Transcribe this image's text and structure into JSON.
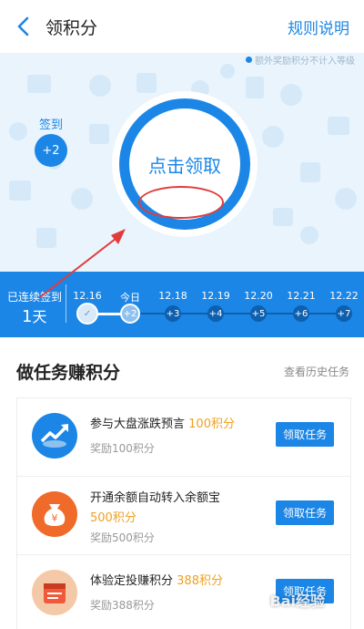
{
  "header": {
    "title": "领积分",
    "rules_label": "规则说明"
  },
  "hero": {
    "note": "额外奖励积分不计入等级",
    "signed_label": "签到",
    "signed_badge": "+2",
    "claim_label": "点击领取"
  },
  "streak": {
    "label": "已连续签到",
    "days_value": "1",
    "days_unit": "天",
    "days": [
      {
        "date": "12.16",
        "reward": "✓",
        "state": "done"
      },
      {
        "date": "今日",
        "reward": "+2",
        "state": "today"
      },
      {
        "date": "12.18",
        "reward": "+3",
        "state": "future"
      },
      {
        "date": "12.19",
        "reward": "+4",
        "state": "future"
      },
      {
        "date": "12.20",
        "reward": "+5",
        "state": "future"
      },
      {
        "date": "12.21",
        "reward": "+6",
        "state": "future"
      },
      {
        "date": "12.22",
        "reward": "+7",
        "state": "future"
      }
    ]
  },
  "tasks": {
    "title": "做任务赚积分",
    "history_label": "查看历史任务",
    "items": [
      {
        "name": "参与大盘涨跌预言",
        "points": "100积分",
        "reward": "奖励100积分",
        "button": "领取任务",
        "icon": "trend-chart-icon",
        "color": "#1c86e6"
      },
      {
        "name": "开通余额自动转入余额宝",
        "points": "500积分",
        "reward": "奖励500积分",
        "button": "领取任务",
        "icon": "money-bag-icon",
        "color": "#f06a2a"
      },
      {
        "name": "体验定投赚积分",
        "points": "388积分",
        "reward": "奖励388积分",
        "button": "领取任务",
        "icon": "calendar-icon",
        "color": "#f05a3a"
      }
    ]
  },
  "watermark": "Bai经验"
}
